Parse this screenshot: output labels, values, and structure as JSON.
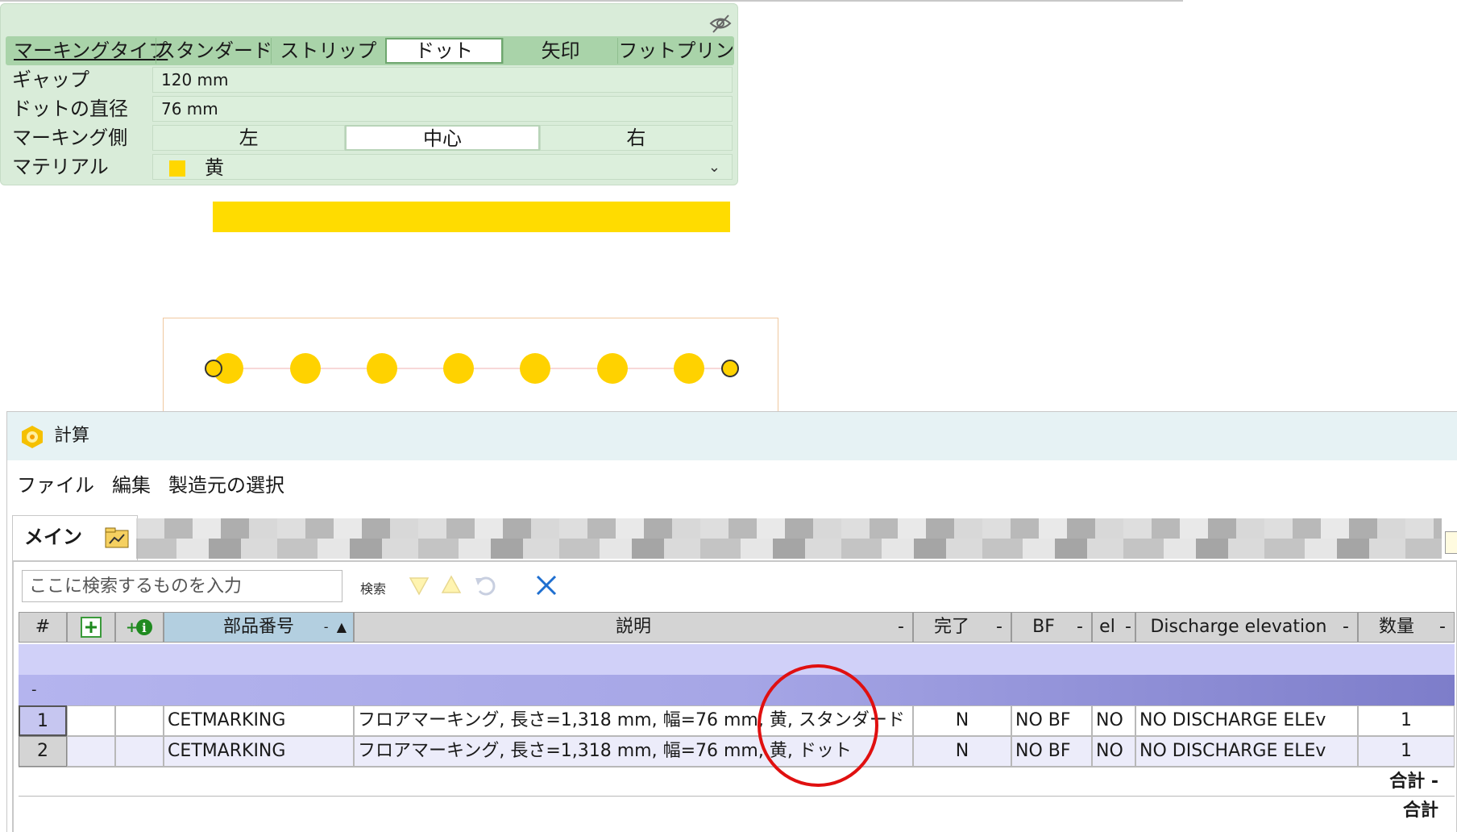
{
  "properties": {
    "marking_type_label": "マーキングタイプ",
    "marking_types": [
      "スタンダード",
      "ストリップ",
      "ドット",
      "矢印",
      "フットプリント"
    ],
    "marking_type_selected": "ドット",
    "gap": {
      "label": "ギャップ",
      "value": "120 mm"
    },
    "dot_diameter": {
      "label": "ドットの直径",
      "value": "76 mm"
    },
    "marking_side": {
      "label": "マーキング側",
      "options": [
        "左",
        "中心",
        "右"
      ],
      "selected": "中心"
    },
    "material": {
      "label": "マテリアル",
      "value": "黄",
      "color": "#ffd700"
    }
  },
  "calc_window": {
    "title": "計算",
    "menu": [
      "ファイル",
      "編集",
      "製造元の選択"
    ],
    "tab_main": "メイン",
    "search_placeholder": "ここに検索するものを入力",
    "search_label": "検索",
    "columns": [
      "#",
      "部品番号",
      "説明",
      "完了",
      "BF",
      "el",
      "Discharge elevation",
      "数量"
    ],
    "group_row_label": "-",
    "rows": [
      {
        "n": "1",
        "part": "CETMARKING",
        "desc": "フロアマーキング, 長さ=1,318 mm, 幅=76 mm, 黄, スタンダード",
        "done": "N",
        "bf": "NO BF",
        "el": "NO",
        "discharge": "NO DISCHARGE ELEv",
        "qty": "1"
      },
      {
        "n": "2",
        "part": "CETMARKING",
        "desc": "フロアマーキング, 長さ=1,318 mm, 幅=76 mm, 黄, ドット",
        "done": "N",
        "bf": "NO BF",
        "el": "NO",
        "discharge": "NO DISCHARGE ELEv",
        "qty": "1"
      }
    ],
    "total_1": "合計 -",
    "total_2": "合計"
  },
  "colors": {
    "panel_bg": "#d9ecd9",
    "marking_yellow": "#ffdc00",
    "highlight_circle": "#e01010"
  }
}
